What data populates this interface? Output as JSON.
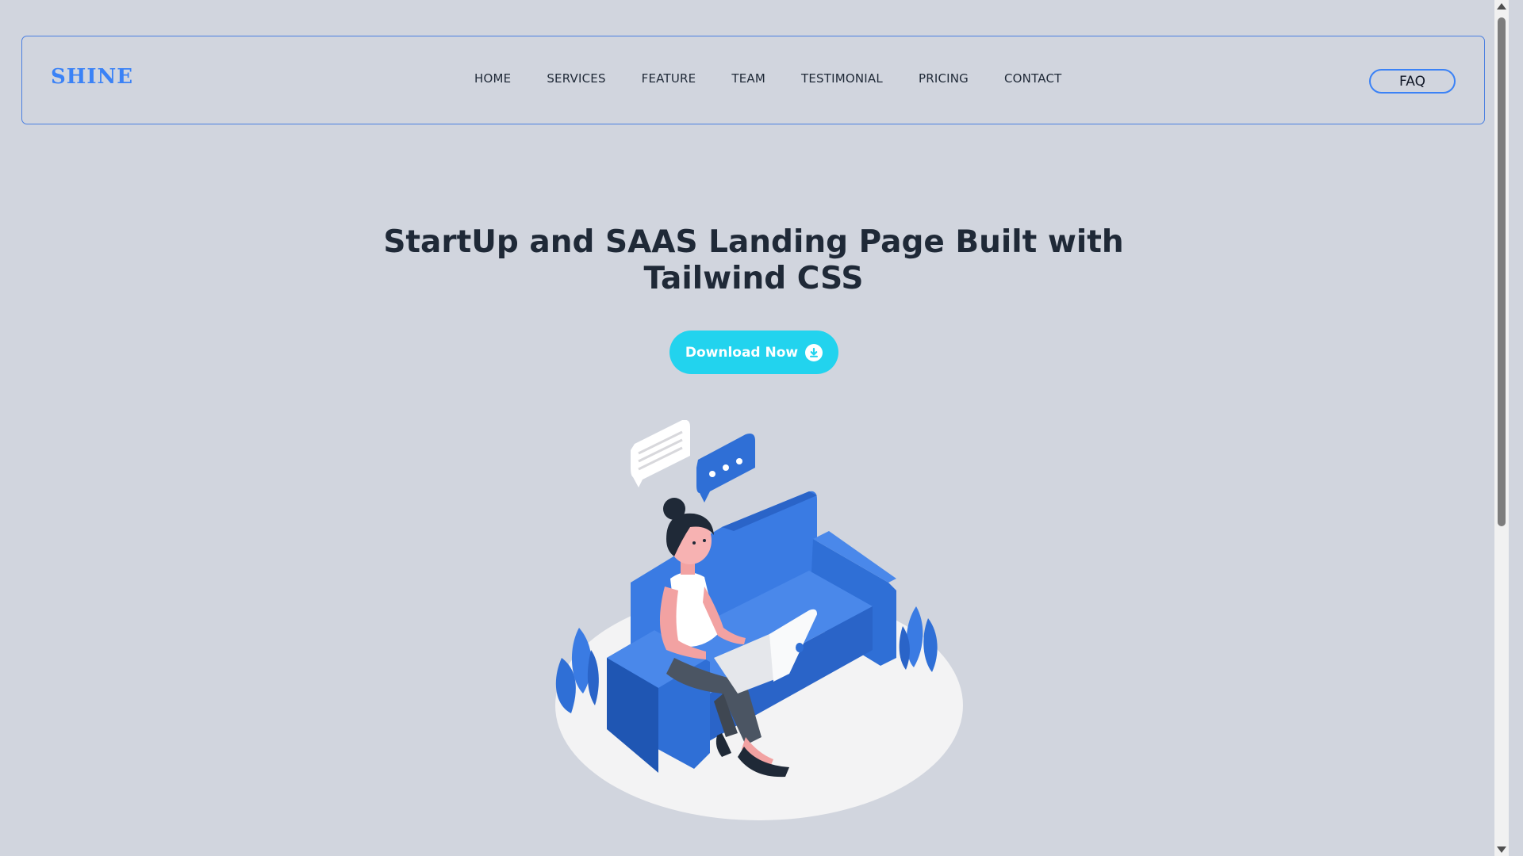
{
  "header": {
    "logo": "SHINE",
    "nav": [
      "HOME",
      "SERVICES",
      "FEATURE",
      "TEAM",
      "TESTIMONIAL",
      "PRICING",
      "CONTACT"
    ],
    "faq_label": "FAQ"
  },
  "hero": {
    "title": "StartUp and SAAS Landing Page Built with Tailwind CSS",
    "download_label": "Download Now",
    "download_icon": "download-circle-icon",
    "illustration": "woman-on-sofa-with-laptop-illustration"
  },
  "colors": {
    "background": "#d1d5de",
    "accent_blue": "#3b82f6",
    "button_cyan": "#22d3ee",
    "text_dark": "#1f2937",
    "sofa_blue": "#2f6fd6"
  }
}
